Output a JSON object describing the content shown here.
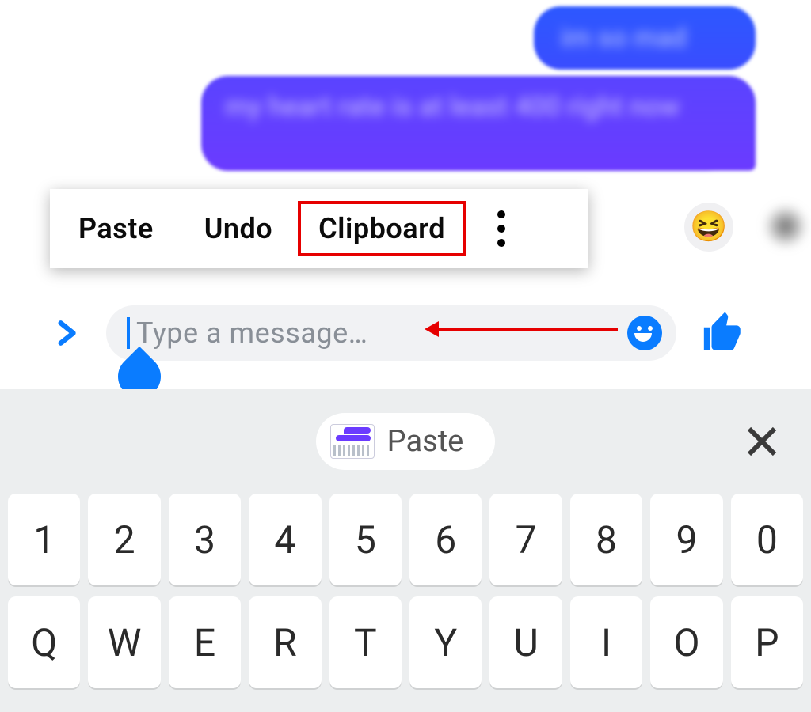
{
  "chat": {
    "bubble1_text": "im so mad",
    "bubble2_text": "my heart rate is at least 400 right now",
    "reaction_emoji": "😆"
  },
  "context_menu": {
    "paste": "Paste",
    "undo": "Undo",
    "clipboard": "Clipboard"
  },
  "input": {
    "placeholder": "Type a message…"
  },
  "keyboard_bar": {
    "paste_label": "Paste"
  },
  "keyboard": {
    "row1": [
      "1",
      "2",
      "3",
      "4",
      "5",
      "6",
      "7",
      "8",
      "9",
      "0"
    ],
    "row2": [
      "Q",
      "W",
      "E",
      "R",
      "T",
      "Y",
      "U",
      "I",
      "O",
      "P"
    ]
  },
  "colors": {
    "accent_blue": "#0A7CFF",
    "bubble_purple": "#6B3BFF",
    "bubble_blue": "#2D58FF",
    "annotation_red": "#E60000",
    "keyboard_bg": "#ECEEEF",
    "input_bg": "#F1F2F4"
  },
  "icons": {
    "expand": "chevron-right-icon",
    "emoji_picker": "smiley-face-icon",
    "send_like": "thumbs-up-icon",
    "menu_overflow": "vertical-dots-icon",
    "close": "close-icon"
  }
}
